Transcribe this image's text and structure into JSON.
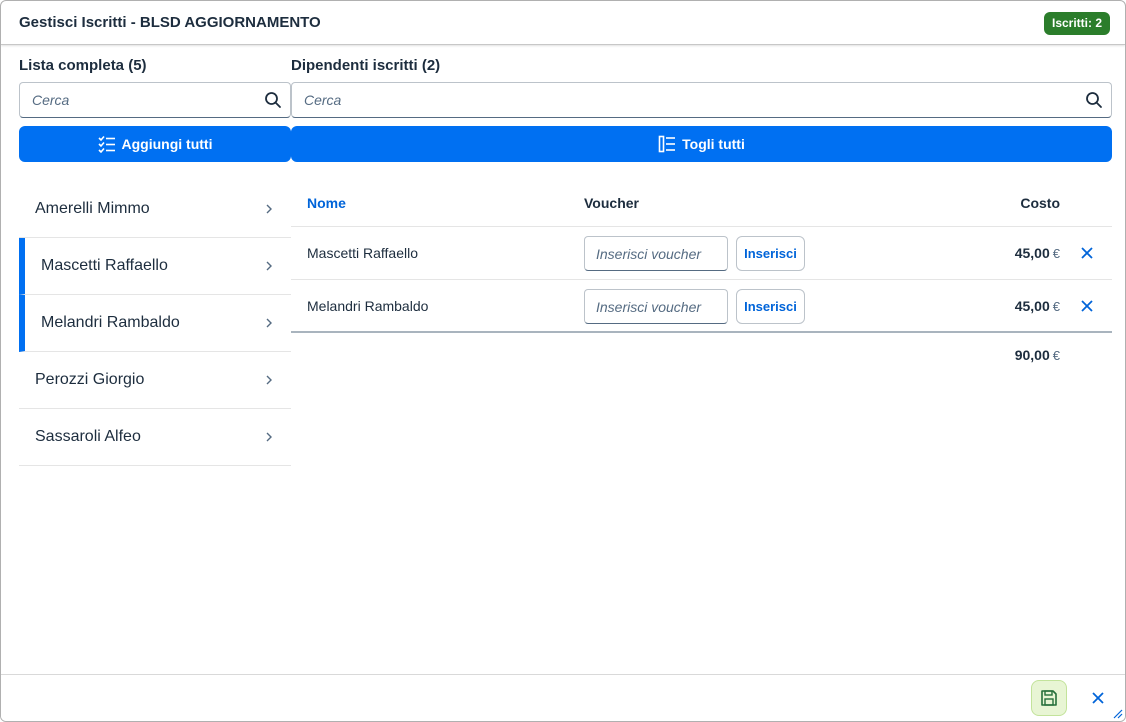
{
  "dialog": {
    "title": "Gestisci Iscritti - BLSD AGGIORNAMENTO",
    "badge": "Iscritti: 2"
  },
  "left": {
    "title": "Lista completa (5)",
    "search_placeholder": "Cerca",
    "add_all_label": "Aggiungi tutti",
    "items": [
      {
        "name": "Amerelli Mimmo",
        "selected": false
      },
      {
        "name": "Mascetti Raffaello",
        "selected": true
      },
      {
        "name": "Melandri Rambaldo",
        "selected": true
      },
      {
        "name": "Perozzi Giorgio",
        "selected": false
      },
      {
        "name": "Sassaroli Alfeo",
        "selected": false
      }
    ]
  },
  "right": {
    "title": "Dipendenti iscritti (2)",
    "search_placeholder": "Cerca",
    "remove_all_label": "Togli tutti",
    "columns": {
      "name": "Nome",
      "voucher": "Voucher",
      "cost": "Costo"
    },
    "rows": [
      {
        "name": "Mascetti Raffaello",
        "voucher_placeholder": "Inserisci voucher",
        "insert_label": "Inserisci",
        "cost": "45,00",
        "currency": "€"
      },
      {
        "name": "Melandri Rambaldo",
        "voucher_placeholder": "Inserisci voucher",
        "insert_label": "Inserisci",
        "cost": "45,00",
        "currency": "€"
      }
    ],
    "total": {
      "amount": "90,00",
      "currency": "€"
    }
  },
  "colors": {
    "accent": "#0070f2",
    "badge": "#2b7d2b",
    "link": "#0064d9"
  }
}
